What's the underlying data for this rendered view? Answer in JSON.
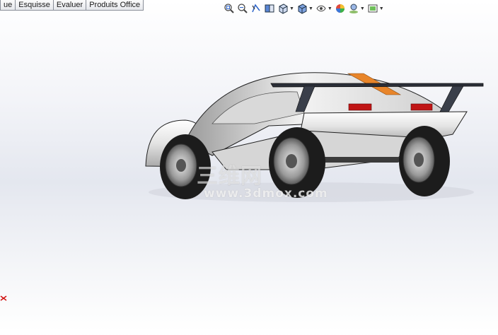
{
  "command_tabs": [
    "ue",
    "Esquisse",
    "Evaluer",
    "Produits Office"
  ],
  "view_toolbar": [
    {
      "icon": "zoom-to-fit-icon",
      "dropdown": false
    },
    {
      "icon": "zoom-to-area-icon",
      "dropdown": false
    },
    {
      "icon": "previous-view-icon",
      "dropdown": false
    },
    {
      "icon": "section-view-icon",
      "dropdown": false
    },
    {
      "icon": "view-orientation-icon",
      "dropdown": true
    },
    {
      "icon": "display-style-icon",
      "dropdown": true
    },
    {
      "icon": "hide-show-items-icon",
      "dropdown": true
    },
    {
      "icon": "edit-appearance-icon",
      "dropdown": false
    },
    {
      "icon": "apply-scene-icon",
      "dropdown": true
    },
    {
      "icon": "view-settings-icon",
      "dropdown": true
    }
  ],
  "watermark": {
    "logo_text": "三维网",
    "url_text": "www.3dmox.com"
  },
  "colors": {
    "accent_stripe": "#e8852a",
    "tail_light": "#c01515",
    "body": "#e6e6e6",
    "tire": "#1c1c1c"
  }
}
